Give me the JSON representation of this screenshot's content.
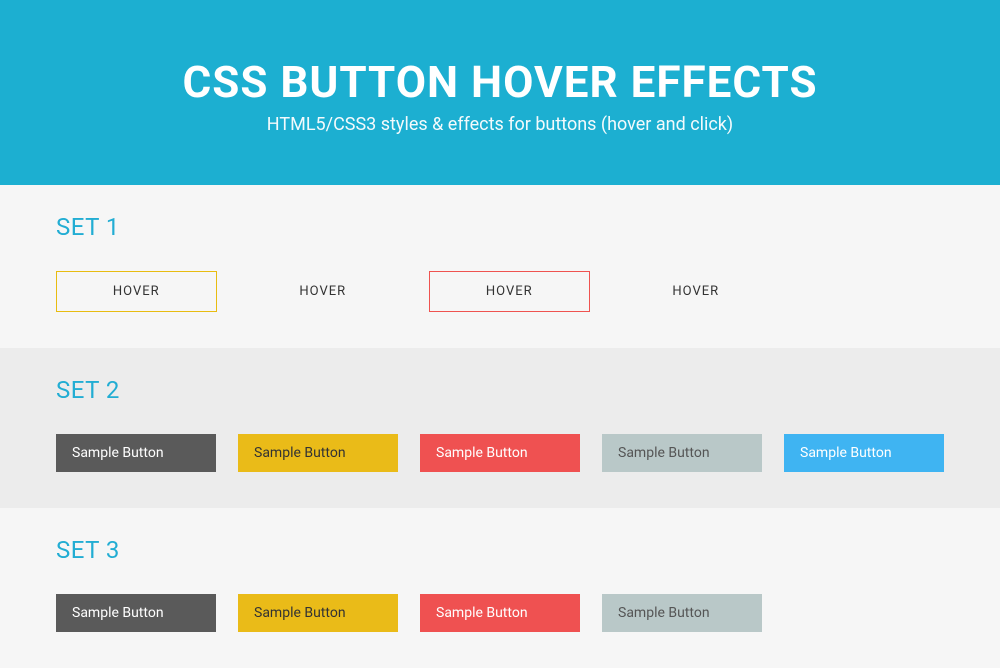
{
  "header": {
    "title": "CSS BUTTON HOVER EFFECTS",
    "subtitle": "HTML5/CSS3 styles & effects for buttons (hover and click)"
  },
  "set1": {
    "title": "SET 1",
    "buttons": [
      {
        "label": "HOVER"
      },
      {
        "label": "HOVER"
      },
      {
        "label": "HOVER"
      },
      {
        "label": "HOVER"
      }
    ]
  },
  "set2": {
    "title": "SET 2",
    "buttons": [
      {
        "label": "Sample Button"
      },
      {
        "label": "Sample Button"
      },
      {
        "label": "Sample Button"
      },
      {
        "label": "Sample Button"
      },
      {
        "label": "Sample Button"
      }
    ]
  },
  "set3": {
    "title": "SET 3",
    "buttons": [
      {
        "label": "Sample Button"
      },
      {
        "label": "Sample Button"
      },
      {
        "label": "Sample Button"
      },
      {
        "label": "Sample Button"
      }
    ]
  },
  "colors": {
    "accent": "#1cafd1",
    "yellow": "#eabb18",
    "red": "#ef5151",
    "grey": "#b9c8c8",
    "blue": "#3fb4f2",
    "dark": "#5a5a5a"
  }
}
